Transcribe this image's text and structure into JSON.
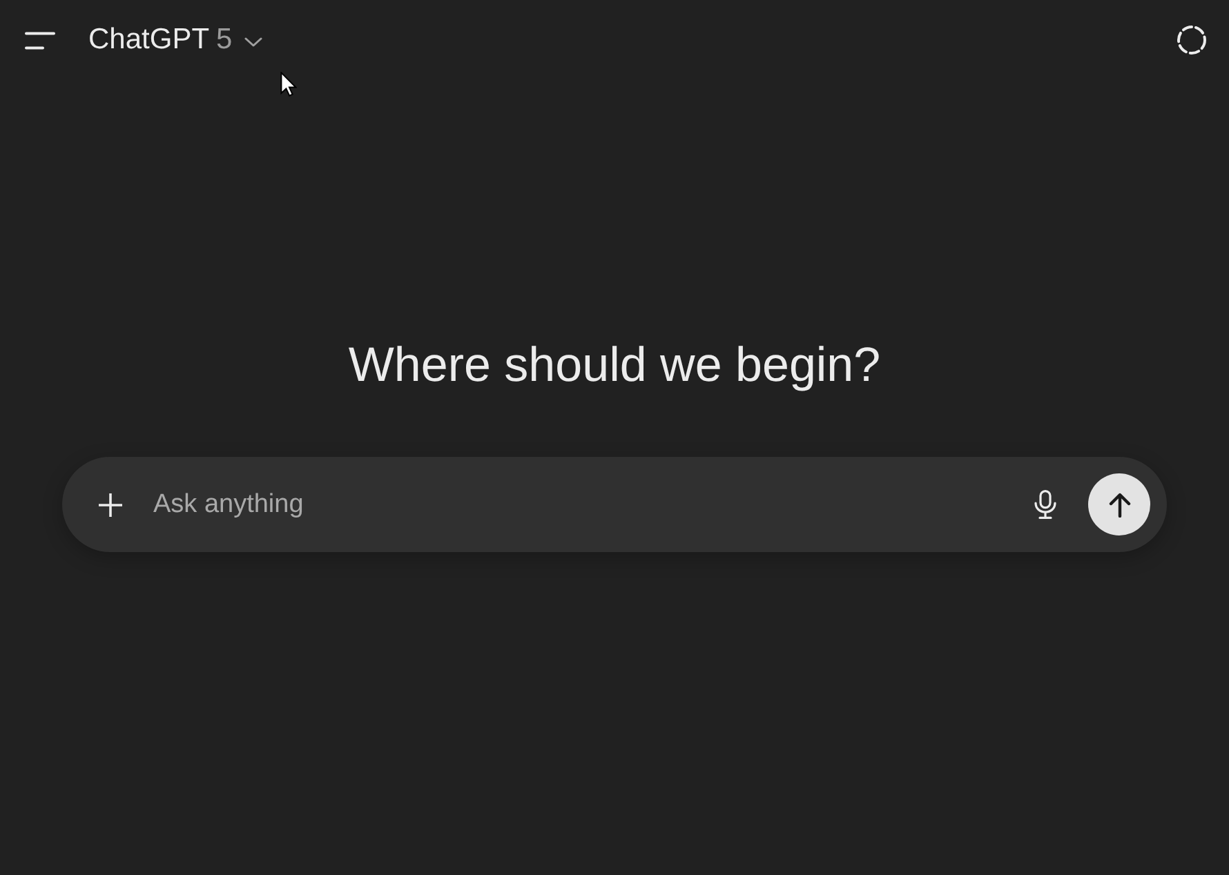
{
  "header": {
    "title": "ChatGPT",
    "model": "5"
  },
  "greeting": "Where should we begin?",
  "composer": {
    "placeholder": "Ask anything"
  }
}
